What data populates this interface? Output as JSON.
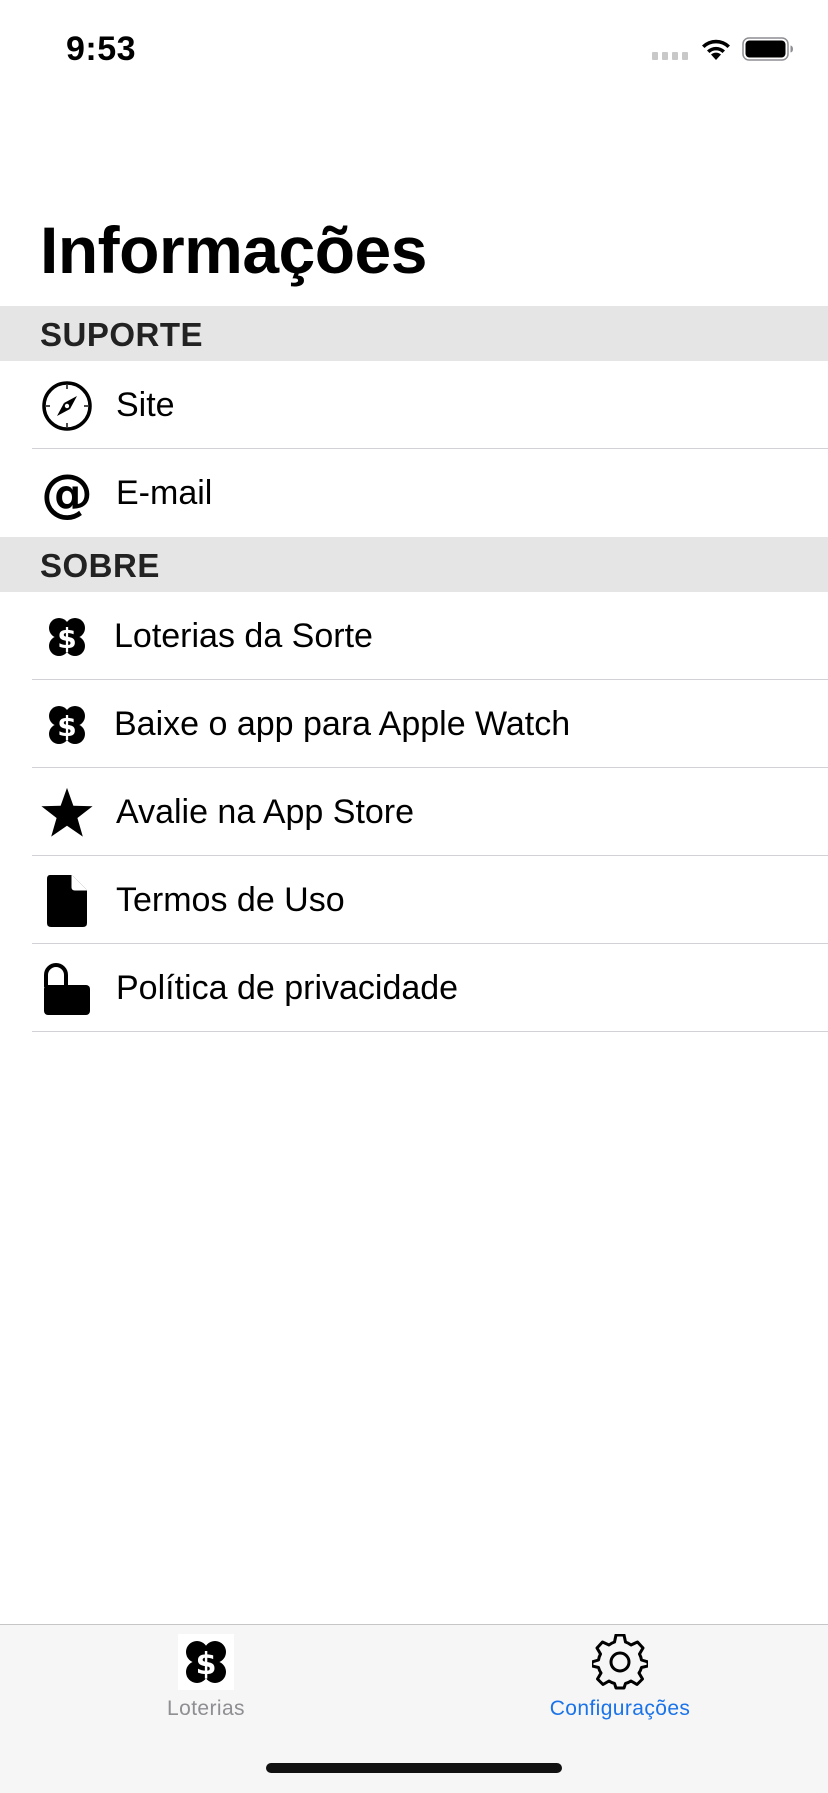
{
  "status_bar": {
    "time": "9:53"
  },
  "title": "Informações",
  "sections": {
    "support": {
      "header": "SUPORTE",
      "items": [
        {
          "label": "Site",
          "icon": "compass-icon"
        },
        {
          "label": "E-mail",
          "icon": "at-sign-icon"
        }
      ]
    },
    "about": {
      "header": "SOBRE",
      "items": [
        {
          "label": "Loterias da Sorte",
          "icon": "clover-dollar-icon"
        },
        {
          "label": "Baixe o app para Apple Watch",
          "icon": "clover-dollar-icon"
        },
        {
          "label": "Avalie na App Store",
          "icon": "star-icon"
        },
        {
          "label": "Termos de Uso",
          "icon": "document-icon"
        },
        {
          "label": "Política de privacidade",
          "icon": "unlocked-padlock-icon"
        }
      ]
    }
  },
  "tab_bar": {
    "tabs": [
      {
        "label": "Loterias",
        "icon": "clover-dollar-icon",
        "active": false
      },
      {
        "label": "Configurações",
        "icon": "gear-icon",
        "active": true
      }
    ]
  },
  "colors": {
    "accent": "#1a73e8",
    "inactive_tab": "#8e8e93",
    "section_header_bg": "#e5e5e5",
    "separator": "#d1d1d6"
  }
}
